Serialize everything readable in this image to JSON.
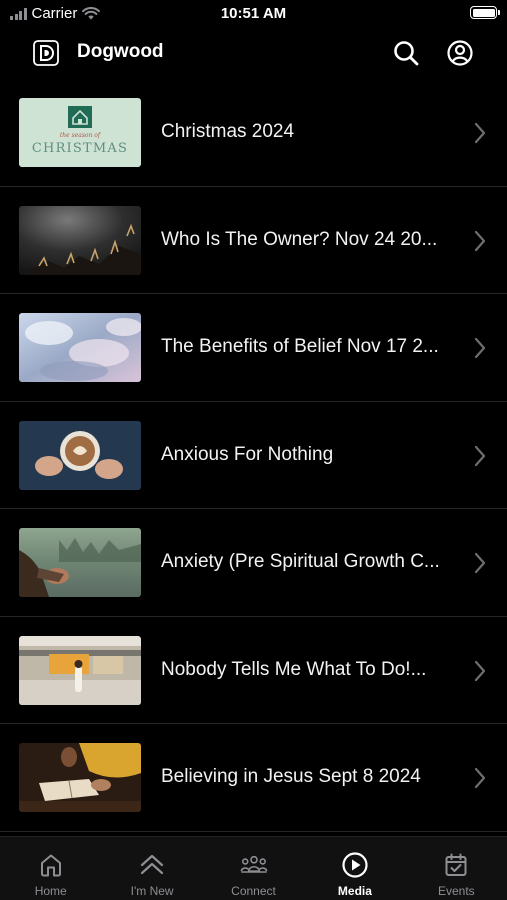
{
  "status_bar": {
    "carrier": "Carrier",
    "time": "10:51 AM",
    "icons": [
      "signal-icon",
      "wifi-icon",
      "battery-icon"
    ]
  },
  "header": {
    "title": "Dogwood",
    "logo_icon": "dogwood-logo-icon",
    "actions": [
      "search-icon",
      "account-icon"
    ]
  },
  "media": {
    "items": [
      {
        "title": "Christmas 2024",
        "thumb_text": "CHRISTMAS",
        "thumb_script": "the season of"
      },
      {
        "title": "Who Is The Owner? Nov 24 20..."
      },
      {
        "title": "The Benefits of Belief Nov 17 2..."
      },
      {
        "title": "Anxious For Nothing"
      },
      {
        "title": "Anxiety (Pre Spiritual Growth C..."
      },
      {
        "title": "Nobody Tells Me What To Do!..."
      },
      {
        "title": "Believing in Jesus Sept 8 2024"
      }
    ]
  },
  "tab_bar": {
    "active": "Media",
    "tabs": [
      {
        "label": "Home",
        "icon": "home-icon"
      },
      {
        "label": "I'm New",
        "icon": "chevrons-up-icon"
      },
      {
        "label": "Connect",
        "icon": "group-icon"
      },
      {
        "label": "Media",
        "icon": "play-circle-icon"
      },
      {
        "label": "Events",
        "icon": "calendar-check-icon"
      }
    ]
  },
  "colors": {
    "background": "#000000",
    "text": "#ffffff",
    "inactive_tab": "#8e8e93",
    "divider": "#262626"
  }
}
